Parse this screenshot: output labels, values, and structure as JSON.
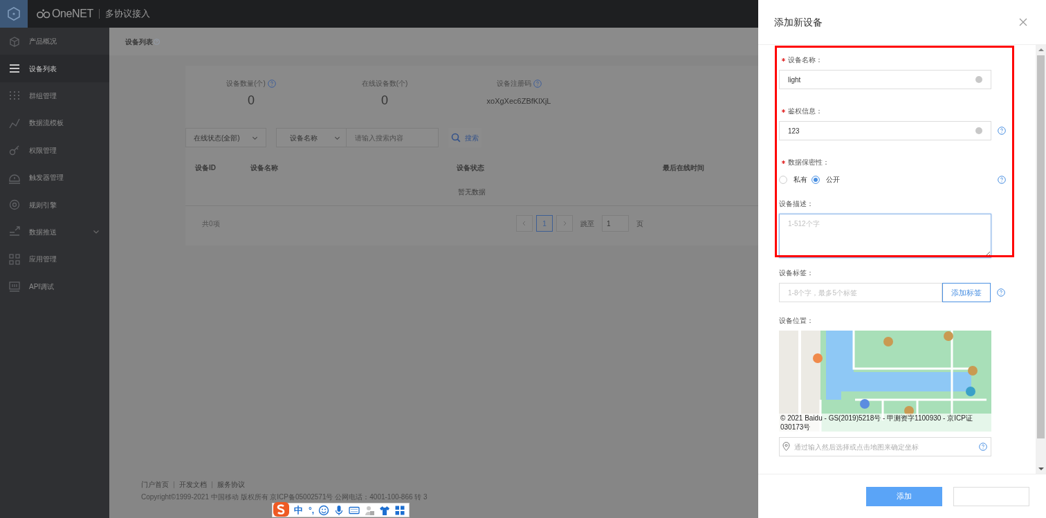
{
  "header": {
    "app_name": "OneNET",
    "module": "多协议接入"
  },
  "sidebar": {
    "items": [
      {
        "label": "产品概况",
        "selected": false,
        "expandable": false
      },
      {
        "label": "设备列表",
        "selected": true,
        "expandable": false
      },
      {
        "label": "群组管理",
        "selected": false,
        "expandable": false
      },
      {
        "label": "数据流模板",
        "selected": false,
        "expandable": false
      },
      {
        "label": "权限管理",
        "selected": false,
        "expandable": false
      },
      {
        "label": "触发器管理",
        "selected": false,
        "expandable": false
      },
      {
        "label": "规则引擎",
        "selected": false,
        "expandable": false
      },
      {
        "label": "数据推送",
        "selected": false,
        "expandable": true
      },
      {
        "label": "应用管理",
        "selected": false,
        "expandable": false
      },
      {
        "label": "API调试",
        "selected": false,
        "expandable": false
      }
    ]
  },
  "page": {
    "title": "设备列表",
    "stats": [
      {
        "label": "设备数量(个)",
        "value": "0",
        "help": true
      },
      {
        "label": "在线设备数(个)",
        "value": "0",
        "help": false
      },
      {
        "label": "设备注册码",
        "value": "xoXgXec6ZBfKlXjL",
        "help": true
      }
    ],
    "filters": {
      "status_select": "在线状态(全部)",
      "field_select": "设备名称",
      "search": {
        "placeholder": "请输入搜索内容"
      },
      "search_button": "搜索"
    },
    "table": {
      "columns": [
        "设备ID",
        "设备名称",
        "设备状态",
        "最后在线时间"
      ],
      "empty_text": "暂无数据"
    },
    "pagination": {
      "total": "共0项",
      "pages": [
        {
          "label": "1",
          "selected": true
        }
      ],
      "jump_label": "跳至",
      "jump_value": "1",
      "page_unit": "页"
    }
  },
  "footer": {
    "links": [
      "门户首页",
      "开发文档",
      "服务协议"
    ],
    "copyright": "Copyright©1999-2021 中国移动 版权所有 京ICP备05002571号 公网电话：4001-100-866 转 3"
  },
  "ime_toolbar": {
    "mode": "中",
    "punctuation": "°,"
  },
  "drawer": {
    "title": "添加新设备",
    "fields": [
      {
        "kind": "text",
        "label": "设备名称：",
        "required": true,
        "value": "light",
        "help": false
      },
      {
        "kind": "text",
        "label": "鉴权信息：",
        "required": true,
        "value": "123",
        "help": true
      },
      {
        "kind": "radio",
        "label": "数据保密性：",
        "required": true,
        "help": true,
        "options": [
          {
            "label": "私有",
            "selected": false
          },
          {
            "label": "公开",
            "selected": true
          }
        ]
      },
      {
        "kind": "textarea",
        "label": "设备描述：",
        "required": false,
        "placeholder": "1-512个字",
        "focused": true,
        "help": false
      },
      {
        "kind": "tags",
        "label": "设备标签：",
        "required": false,
        "placeholder": "1-8个字，最多5个标签",
        "button": "添加标签",
        "help": true
      },
      {
        "kind": "map",
        "label": "设备位置：",
        "required": false,
        "attribution": "© 2021 Baidu - GS(2019)5218号 - 甲测资字1100930 - 京ICP证030173号",
        "placeholder": "通过输入然后选择或点击地图来确定坐标",
        "help": true
      }
    ],
    "buttons": [
      {
        "kind": "primary",
        "label": "添加"
      },
      {
        "kind": "default"
      }
    ]
  }
}
